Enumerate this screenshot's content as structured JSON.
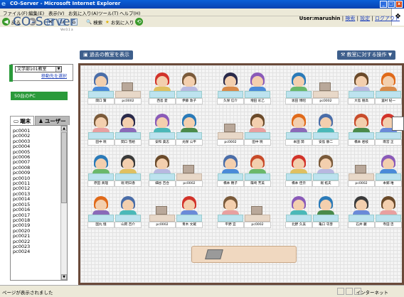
{
  "window": {
    "title": "CO-Server - Microsoft Internet Explorer",
    "min": "_",
    "max": "□",
    "close": "x"
  },
  "menu": [
    "ファイル(F)",
    "編集(E)",
    "表示(V)",
    "お気に入り(A)",
    "ツール(T)",
    "ヘルプ(H)"
  ],
  "toolbar": {
    "back": "戻る",
    "search": "検索",
    "favorites": "お気に入り"
  },
  "header": {
    "logo": "CO-Server",
    "version": "Ver.0.1 a",
    "user": "User:marushin",
    "links": {
      "search": "検索",
      "settings": "設定",
      "logout": "ログアウト"
    },
    "past_room_button": "過去の教室を表示",
    "room_action_button": "教室に対する操作 ▼"
  },
  "sidebar": {
    "room_select": "文学部101教室",
    "move_link": "移動先を選択",
    "pc_count": "50台のPC",
    "tabs": {
      "terminal": "端末",
      "users": "ユーザー"
    },
    "pc_list": [
      "pc0001",
      "pc0002",
      "pc0003",
      "pc0004",
      "pc0005",
      "pc0006",
      "pc0007",
      "pc0008",
      "pc0009",
      "pc0010",
      "pc0011",
      "pc0012",
      "pc0013",
      "pc0014",
      "pc0015",
      "pc0016",
      "pc0017",
      "pc0018",
      "pc0019",
      "pc0020",
      "pc0021",
      "pc0022",
      "pc0023",
      "pc0024"
    ]
  },
  "seats": {
    "r1": [
      "関口 賢",
      "pc0002",
      "西島 愛",
      "伊藤 敦子",
      "久保 信介",
      "増田 彩乙",
      "坂田 博昭",
      "pc0002",
      "大島 朋高",
      "里村 紀一"
    ],
    "r2": [
      "田中 暁",
      "関口 雪絵",
      "安和 貴志",
      "光保 公平",
      "pc0002",
      "田中 暁",
      "本田 潤",
      "安島 静二",
      "橋本 君枝",
      "雨宮 正"
    ],
    "r3": [
      "原田 真理",
      "堀 明日香",
      "細谷 百合",
      "pc0002",
      "橋本 穂子",
      "篠崎 芳美",
      "橋本 佳奈",
      "堀 拓夫",
      "pc0002",
      "本郷 唯"
    ],
    "r4": [
      "国丸 憶",
      "山岡 百介",
      "pc0002",
      "青木 文蔵",
      "平野 宜",
      "pc0002",
      "北野 久美",
      "亀口 守彦",
      "石井 麗",
      "寺田 忠"
    ]
  },
  "status": {
    "text": "ページが表示されました",
    "zone": "インターネット"
  }
}
